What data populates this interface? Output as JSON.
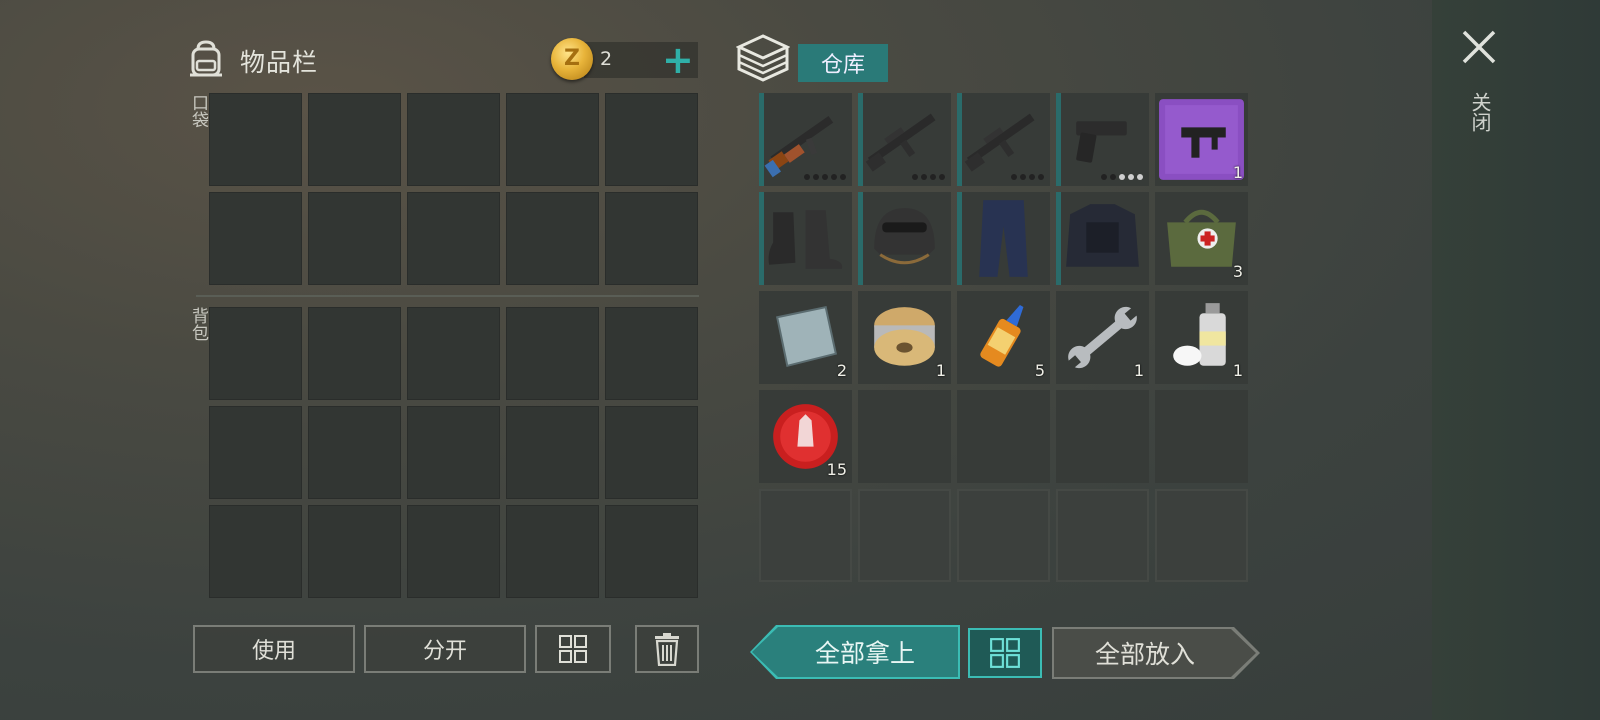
{
  "inventory": {
    "title": "物品栏",
    "pocket_label": "口袋",
    "backpack_label": "背包"
  },
  "currency": {
    "count": "2",
    "add_label": "+"
  },
  "left_buttons": {
    "use": "使用",
    "split": "分开"
  },
  "storage": {
    "tab_label": "仓库",
    "items": [
      {
        "name": "ak-rifle-icon",
        "count": "",
        "dots": 5,
        "dots_on": 0,
        "bar": true
      },
      {
        "name": "assault-rifle-icon",
        "count": "",
        "dots": 4,
        "dots_on": 0,
        "bar": true
      },
      {
        "name": "assault-rifle-icon",
        "count": "",
        "dots": 4,
        "dots_on": 0,
        "bar": true
      },
      {
        "name": "pistol-icon",
        "count": "",
        "dots": 5,
        "dots_on": 3,
        "bar": true
      },
      {
        "name": "smg-blueprint-icon",
        "count": "1",
        "dots": 0,
        "dots_on": 0,
        "bar": false
      },
      {
        "name": "boots-icon",
        "count": "",
        "dots": 0,
        "dots_on": 0,
        "bar": true
      },
      {
        "name": "helmet-icon",
        "count": "",
        "dots": 0,
        "dots_on": 0,
        "bar": true
      },
      {
        "name": "pants-icon",
        "count": "",
        "dots": 0,
        "dots_on": 0,
        "bar": true
      },
      {
        "name": "tactical-vest-icon",
        "count": "",
        "dots": 0,
        "dots_on": 0,
        "bar": true
      },
      {
        "name": "medkit-bag-icon",
        "count": "3",
        "dots": 0,
        "dots_on": 0,
        "bar": false
      },
      {
        "name": "metal-plate-icon",
        "count": "2",
        "dots": 0,
        "dots_on": 0,
        "bar": false
      },
      {
        "name": "wire-spool-icon",
        "count": "1",
        "dots": 0,
        "dots_on": 0,
        "bar": false
      },
      {
        "name": "glue-icon",
        "count": "5",
        "dots": 0,
        "dots_on": 0,
        "bar": false
      },
      {
        "name": "wrench-icon",
        "count": "1",
        "dots": 0,
        "dots_on": 0,
        "bar": false
      },
      {
        "name": "spray-paint-icon",
        "count": "1",
        "dots": 0,
        "dots_on": 0,
        "bar": false
      },
      {
        "name": "bottle-cap-icon",
        "count": "15",
        "dots": 0,
        "dots_on": 0,
        "bar": false
      }
    ]
  },
  "bottom_buttons": {
    "take_all": "全部拿上",
    "put_all": "全部放入"
  },
  "close": {
    "label": "关闭"
  },
  "colors": {
    "accent": "#2a807c",
    "accent_light": "#3bbcb4",
    "cell": "#323633"
  }
}
